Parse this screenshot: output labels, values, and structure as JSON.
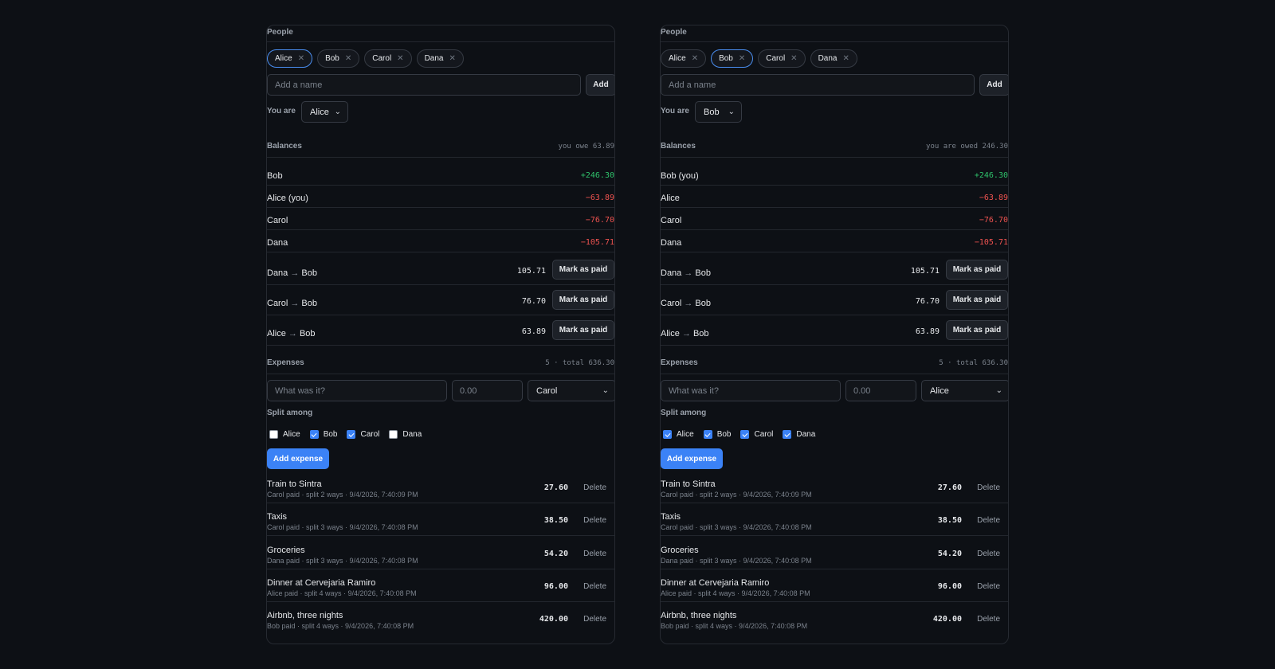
{
  "panels": [
    {
      "people_label": "People",
      "people": [
        {
          "name": "Alice",
          "active": true
        },
        {
          "name": "Bob",
          "active": false
        },
        {
          "name": "Carol",
          "active": false
        },
        {
          "name": "Dana",
          "active": false
        }
      ],
      "add_name_placeholder": "Add a name",
      "add_label": "Add",
      "you_are_label": "You are",
      "you_are_value": "Alice",
      "balances_label": "Balances",
      "balances_summary": "you owe 63.89",
      "balances": [
        {
          "name": "Bob",
          "value": "+246.30",
          "kind": "pos"
        },
        {
          "name": "Alice (you)",
          "value": "−63.89",
          "kind": "neg"
        },
        {
          "name": "Carol",
          "value": "−76.70",
          "kind": "neg"
        },
        {
          "name": "Dana",
          "value": "−105.71",
          "kind": "neg"
        }
      ],
      "settlements": [
        {
          "from": "Dana",
          "to": "Bob",
          "amount": "105.71",
          "action": "Mark as paid"
        },
        {
          "from": "Carol",
          "to": "Bob",
          "amount": "76.70",
          "action": "Mark as paid"
        },
        {
          "from": "Alice",
          "to": "Bob",
          "amount": "63.89",
          "action": "Mark as paid"
        }
      ],
      "expenses_label": "Expenses",
      "expenses_summary": "5 · total 636.30",
      "what_placeholder": "What was it?",
      "amount_placeholder": "0.00",
      "payer_value": "Carol",
      "split_label": "Split among",
      "split": [
        {
          "name": "Alice",
          "checked": false
        },
        {
          "name": "Bob",
          "checked": true
        },
        {
          "name": "Carol",
          "checked": true
        },
        {
          "name": "Dana",
          "checked": false
        }
      ],
      "add_expense_label": "Add expense",
      "expenses": [
        {
          "title": "Train to Sintra",
          "meta": "Carol paid · split 2 ways · 9/4/2026, 7:40:09 PM",
          "amount": "27.60",
          "action": "Delete"
        },
        {
          "title": "Taxis",
          "meta": "Carol paid · split 3 ways · 9/4/2026, 7:40:08 PM",
          "amount": "38.50",
          "action": "Delete"
        },
        {
          "title": "Groceries",
          "meta": "Dana paid · split 3 ways · 9/4/2026, 7:40:08 PM",
          "amount": "54.20",
          "action": "Delete"
        },
        {
          "title": "Dinner at Cervejaria Ramiro",
          "meta": "Alice paid · split 4 ways · 9/4/2026, 7:40:08 PM",
          "amount": "96.00",
          "action": "Delete"
        },
        {
          "title": "Airbnb, three nights",
          "meta": "Bob paid · split 4 ways · 9/4/2026, 7:40:08 PM",
          "amount": "420.00",
          "action": "Delete"
        }
      ]
    },
    {
      "people_label": "People",
      "people": [
        {
          "name": "Alice",
          "active": false
        },
        {
          "name": "Bob",
          "active": true
        },
        {
          "name": "Carol",
          "active": false
        },
        {
          "name": "Dana",
          "active": false
        }
      ],
      "add_name_placeholder": "Add a name",
      "add_label": "Add",
      "you_are_label": "You are",
      "you_are_value": "Bob",
      "balances_label": "Balances",
      "balances_summary": "you are owed 246.30",
      "balances": [
        {
          "name": "Bob (you)",
          "value": "+246.30",
          "kind": "pos"
        },
        {
          "name": "Alice",
          "value": "−63.89",
          "kind": "neg"
        },
        {
          "name": "Carol",
          "value": "−76.70",
          "kind": "neg"
        },
        {
          "name": "Dana",
          "value": "−105.71",
          "kind": "neg"
        }
      ],
      "settlements": [
        {
          "from": "Dana",
          "to": "Bob",
          "amount": "105.71",
          "action": "Mark as paid"
        },
        {
          "from": "Carol",
          "to": "Bob",
          "amount": "76.70",
          "action": "Mark as paid"
        },
        {
          "from": "Alice",
          "to": "Bob",
          "amount": "63.89",
          "action": "Mark as paid"
        }
      ],
      "expenses_label": "Expenses",
      "expenses_summary": "5 · total 636.30",
      "what_placeholder": "What was it?",
      "amount_placeholder": "0.00",
      "payer_value": "Alice",
      "split_label": "Split among",
      "split": [
        {
          "name": "Alice",
          "checked": true
        },
        {
          "name": "Bob",
          "checked": true
        },
        {
          "name": "Carol",
          "checked": true
        },
        {
          "name": "Dana",
          "checked": true
        }
      ],
      "add_expense_label": "Add expense",
      "expenses": [
        {
          "title": "Train to Sintra",
          "meta": "Carol paid · split 2 ways · 9/4/2026, 7:40:09 PM",
          "amount": "27.60",
          "action": "Delete"
        },
        {
          "title": "Taxis",
          "meta": "Carol paid · split 3 ways · 9/4/2026, 7:40:08 PM",
          "amount": "38.50",
          "action": "Delete"
        },
        {
          "title": "Groceries",
          "meta": "Dana paid · split 3 ways · 9/4/2026, 7:40:08 PM",
          "amount": "54.20",
          "action": "Delete"
        },
        {
          "title": "Dinner at Cervejaria Ramiro",
          "meta": "Alice paid · split 4 ways · 9/4/2026, 7:40:08 PM",
          "amount": "96.00",
          "action": "Delete"
        },
        {
          "title": "Airbnb, three nights",
          "meta": "Bob paid · split 4 ways · 9/4/2026, 7:40:08 PM",
          "amount": "420.00",
          "action": "Delete"
        }
      ]
    }
  ]
}
